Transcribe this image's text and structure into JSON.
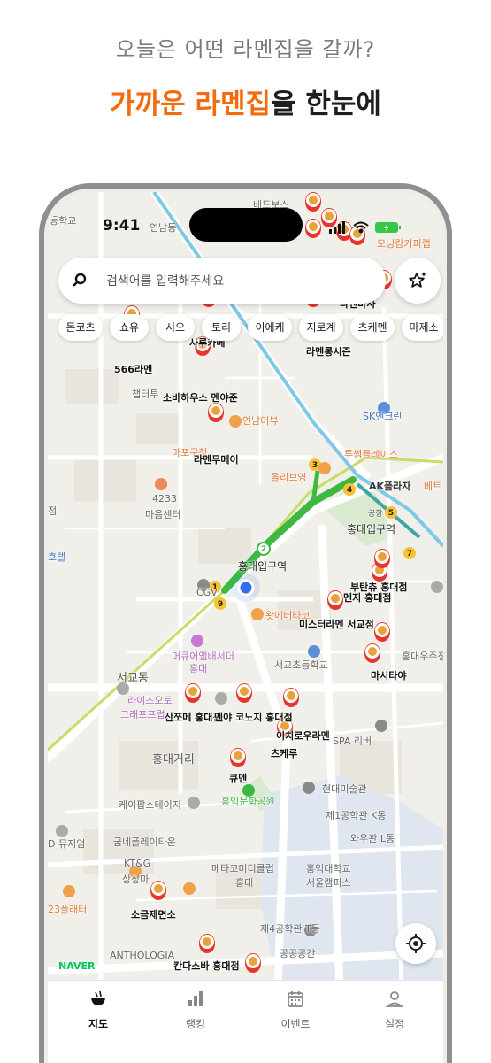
{
  "promo": {
    "subtitle": "오늘은 어떤 라멘집을 갈까?",
    "title_highlight": "가까운 라멘집",
    "title_rest": "을 한눈에"
  },
  "status_bar": {
    "time": "9:41"
  },
  "search": {
    "placeholder": "검색어를 입력해주세요"
  },
  "chips": [
    "돈코츠",
    "쇼유",
    "시오",
    "토리",
    "이에케",
    "지로계",
    "츠케멘",
    "마제소"
  ],
  "ramen_pins": [
    "566라멘",
    "소바하우스 멘야준",
    "라멘무메이",
    "라멘롱시즌",
    "사루카메",
    "미스터라멘 서교점",
    "멘지 홍대점",
    "부탄츄 홍대점",
    "마시타야",
    "츠케루",
    "산쪼메 홍대점",
    "멘야 코노지 홍대점",
    "이치로우라멘",
    "큐멘",
    "소금제면소",
    "칸다소바 홍대점",
    "라멘바사"
  ],
  "place_labels": {
    "hongik_station": "홍대입구역",
    "hongik_station2": "홍대입구역",
    "cgv": "CGV",
    "olive": "올리브영",
    "ak": "AK플라자",
    "sk": "SK엔크린",
    "twosome": "투썸플레이스",
    "mapo": "마포구청",
    "yeonnam": "연남어뷰",
    "maeum": "마음센터",
    "maeum_num": "4233",
    "chapter": "챕터투",
    "wat": "왓에버타코",
    "mercure": "머큐어앰배서더",
    "mercure2": "홍대",
    "seogyo_school": "서교초등학교",
    "seogyo": "서교동",
    "lions": "라이즈오토",
    "lions2": "그래프프럽",
    "hongdae_street": "홍대거리",
    "kpop": "케이팝스테이지",
    "hongik_park": "홍익문화공원",
    "hyundai": "현대미술관",
    "eng": "제1공학관 K동",
    "waw": "와우관 L동",
    "hongik_univ": "홍익대학교",
    "hongik_univ2": "서울캠퍼스",
    "eng4": "제4공학관 T동",
    "public": "공공공간",
    "metaverse": "메타코미디클럽",
    "metaverse2": "홍대",
    "kt": "KT&G",
    "kt2": "상상마",
    "anthology": "ANTHOLOGIA",
    "gubne": "굽네플레이타운",
    "d": "D 뮤지엄",
    "hotel": "23플래터",
    "baedal": "배드보스",
    "monami": "모닝캄커피랩",
    "yeonnam_dong": "연남동",
    "hakgyo": "등학교",
    "ssoo": "홍대우주정",
    "bett": "베트",
    "gonghang": "공항",
    "ho": "호텔",
    "jeom": "점",
    "spa": "SPA 리버"
  },
  "tabs": [
    {
      "label": "지도",
      "icon": "ramen-bowl-icon",
      "active": true
    },
    {
      "label": "랭킹",
      "icon": "bar-chart-icon",
      "active": false
    },
    {
      "label": "이벤트",
      "icon": "calendar-icon",
      "active": false
    },
    {
      "label": "설정",
      "icon": "person-icon",
      "active": false
    }
  ],
  "naver": "NAVER",
  "subway_numbers": [
    "2",
    "3",
    "4",
    "5",
    "7",
    "9",
    "1"
  ],
  "colors": {
    "accent": "#f26b0f",
    "subway_green": "#3db843",
    "pin_red": "#e8342a",
    "map_bg": "#f1efe9"
  }
}
